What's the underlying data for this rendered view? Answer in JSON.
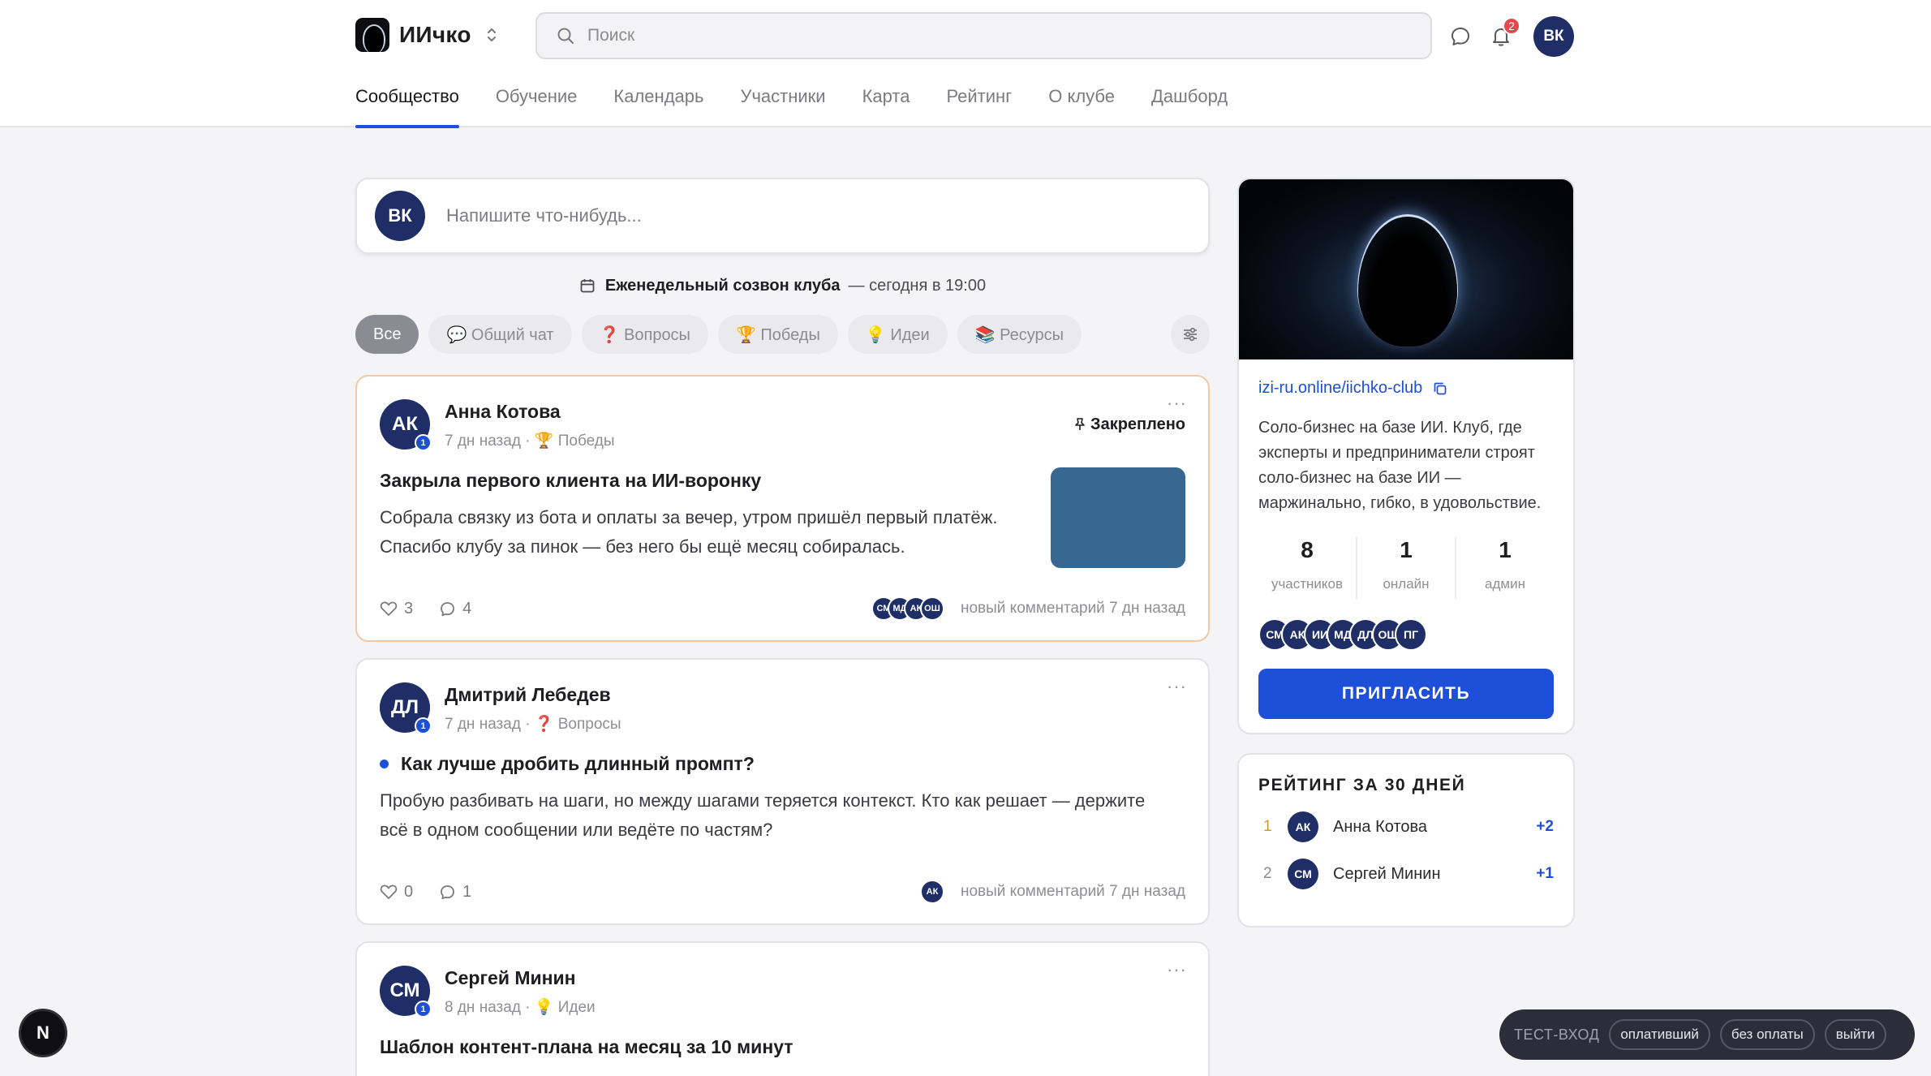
{
  "brand": {
    "name": "ИИчко"
  },
  "search": {
    "placeholder": "Поиск"
  },
  "header": {
    "notifications_count": "2",
    "user_initials": "ВК"
  },
  "nav": {
    "tabs": [
      {
        "label": "Сообщество",
        "active": true
      },
      {
        "label": "Обучение"
      },
      {
        "label": "Календарь"
      },
      {
        "label": "Участники"
      },
      {
        "label": "Карта"
      },
      {
        "label": "Рейтинг"
      },
      {
        "label": "О клубе"
      },
      {
        "label": "Дашборд"
      }
    ]
  },
  "composer": {
    "user_initials": "ВК",
    "placeholder": "Напишите что-нибудь..."
  },
  "event": {
    "title": "Еженедельный созвон клуба",
    "when": "— сегодня в 19:00"
  },
  "filters": [
    {
      "label": "Все",
      "active": true
    },
    {
      "label": "💬 Общий чат"
    },
    {
      "label": "❓ Вопросы"
    },
    {
      "label": "🏆 Победы"
    },
    {
      "label": "💡 Идеи"
    },
    {
      "label": "📚 Ресурсы"
    }
  ],
  "posts": [
    {
      "initials": "АК",
      "level": "1",
      "author": "Анна Котова",
      "meta": "7 дн назад · 🏆 Победы",
      "pinned_label": "Закреплено",
      "title": "Закрыла первого клиента на ИИ-воронку",
      "body": "Собрала связку из бота и оплаты за вечер, утром пришёл первый платёж. Спасибо клубу за пинок — без него бы ещё месяц собиралась.",
      "likes": "3",
      "comments": "4",
      "commenters": [
        "СМ",
        "МД",
        "АК",
        "ОШ"
      ],
      "last_activity": "новый комментарий 7 дн назад"
    },
    {
      "initials": "ДЛ",
      "level": "1",
      "author": "Дмитрий Лебедев",
      "meta": "7 дн назад · ❓ Вопросы",
      "title": "Как лучше дробить длинный промпт?",
      "body": "Пробую разбивать на шаги, но между шагами теряется контекст. Кто как решает — держите всё в одном сообщении или ведёте по частям?",
      "likes": "0",
      "comments": "1",
      "commenters": [
        "АК"
      ],
      "last_activity": "новый комментарий 7 дн назад"
    },
    {
      "initials": "СМ",
      "level": "1",
      "author": "Сергей Минин",
      "meta": "8 дн назад · 💡 Идеи",
      "title": "Шаблон контент-плана на месяц за 10 минут"
    }
  ],
  "club": {
    "link": "izi-ru.online/iichko-club",
    "description": "Соло-бизнес на базе ИИ. Клуб, где эксперты и предприниматели строят соло-бизнес на базе ИИ — маржинально, гибко, в удовольствие.",
    "stats": [
      {
        "value": "8",
        "label": "участников"
      },
      {
        "value": "1",
        "label": "онлайн"
      },
      {
        "value": "1",
        "label": "админ"
      }
    ],
    "members": [
      "СМ",
      "АК",
      "ИИ",
      "МД",
      "ДЛ",
      "ОШ",
      "ПГ"
    ],
    "invite_label": "ПРИГЛАСИТЬ"
  },
  "rating": {
    "title": "РЕЙТИНГ ЗА 30 ДНЕЙ",
    "rows": [
      {
        "rank": "1",
        "initials": "АК",
        "name": "Анна Котова",
        "score": "+2"
      },
      {
        "rank": "2",
        "initials": "СМ",
        "name": "Сергей Минин",
        "score": "+1"
      }
    ]
  },
  "devtools": {
    "letter": "N"
  },
  "testbar": {
    "label": "ТЕСТ-ВХОД",
    "paid": "оплативший",
    "unpaid": "без оплаты",
    "logout": "выйти"
  },
  "colors": {
    "accent": "#1d4fd8",
    "avatar": "#1f2e67",
    "badge": "#e5484d",
    "pinned_border": "#f2c9a0"
  }
}
